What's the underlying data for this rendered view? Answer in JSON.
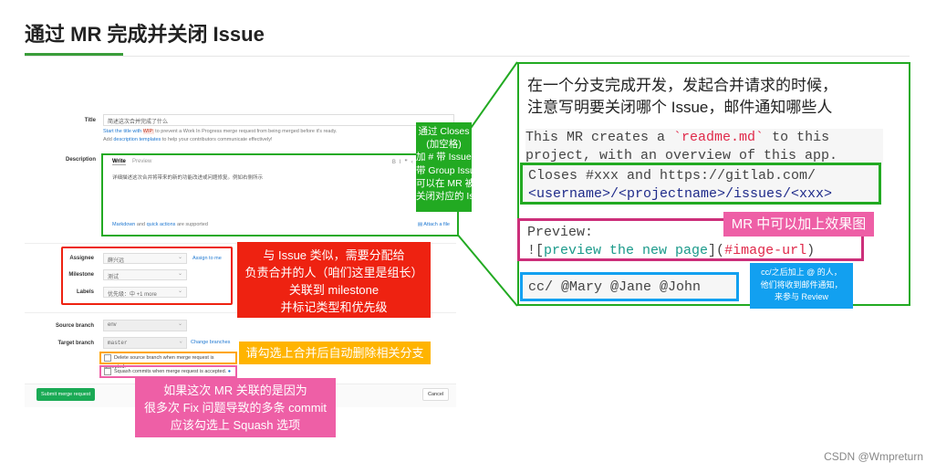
{
  "slide": {
    "title": "通过 MR 完成并关闭 Issue",
    "watermark": "CSDN @Wmpreturn"
  },
  "form": {
    "title_label": "Title",
    "title_value": "简述这次合并完成了什么",
    "wip_hint_pre": "Start the title with",
    "wip_tag": "WIP:",
    "wip_hint_post": "to prevent a Work In Progress merge request from being merged before it's ready.",
    "template_pre": "Add",
    "template_link": "description templates",
    "template_post": "to help your contributors communicate effectively!",
    "description_label": "Description",
    "tab_write": "Write",
    "tab_preview": "Preview",
    "toolbar": [
      "B",
      "I",
      "❞",
      "‹›",
      "🔗",
      "☰",
      "☷"
    ],
    "description_value": "详细描述这次合并将带来的新的功能改进或问题修复。例如右侧所示",
    "markdown_link": "Markdown",
    "and": "and",
    "quick_actions": "quick actions",
    "supported": "are supported",
    "attach": "Attach a file",
    "assignee_label": "Assignee",
    "assignee_value": "薛兴远",
    "assign_to_me": "Assign to me",
    "milestone_label": "Milestone",
    "milestone_value": "测试",
    "labels_label": "Labels",
    "labels_value": "优先级：中 +1 more",
    "source_label": "Source branch",
    "source_value": "env",
    "target_label": "Target branch",
    "target_value": "master",
    "change_branches": "Change branches",
    "delete_branch": "Delete source branch when merge request is accepted.",
    "squash": "Squash commits when merge request is accepted.",
    "submit": "Submit merge request",
    "cancel": "Cancel"
  },
  "callouts": {
    "closes": [
      "通过 Closes",
      "(加空格)",
      "加 # 带 Issue ID 或",
      "带 Group Issue 地址",
      "可以在 MR 被合并后",
      "关闭对应的 Issue"
    ],
    "assign": [
      "与 Issue 类似，需要分配给",
      "负责合并的人（咱们这里是组长）",
      "关联到 milestone",
      "并标记类型和优先级"
    ],
    "delete": "请勾选上合并后自动删除相关分支",
    "squash": [
      "如果这次 MR 关联的是因为",
      "很多次 Fix 问题导致的多条 commit",
      "应该勾选上 Squash 选项"
    ],
    "preview": "MR 中可以加上效果图",
    "cc": [
      "cc/之后加上 @ 的人，",
      "他们将收到邮件通知，",
      "来参与 Review"
    ]
  },
  "example": {
    "heading": [
      "在一个分支完成开发，发起合并请求的时候，",
      "注意写明要关闭哪个 Issue，邮件通知哪些人"
    ],
    "line1_pre": "This MR creates a ",
    "line1_code": "`readme.md`",
    "line1_post": " to this",
    "line2": "project, with an overview of this app.",
    "closes1": "Closes #xxx and https://gitlab.com/",
    "closes2": "<username>/<projectname>/issues/<xxx>",
    "preview1": "Preview:",
    "preview2_a": "![",
    "preview2_b": "preview the new page",
    "preview2_c": "](",
    "preview2_d": "#image-url",
    "preview2_e": ")",
    "cc": "cc/ @Mary @Jane @John"
  },
  "colors": {
    "green": "#22aa22",
    "red": "#ee2211",
    "orange": "#ffa500",
    "pink": "#ee5fa6",
    "blue": "#12a0f0"
  }
}
